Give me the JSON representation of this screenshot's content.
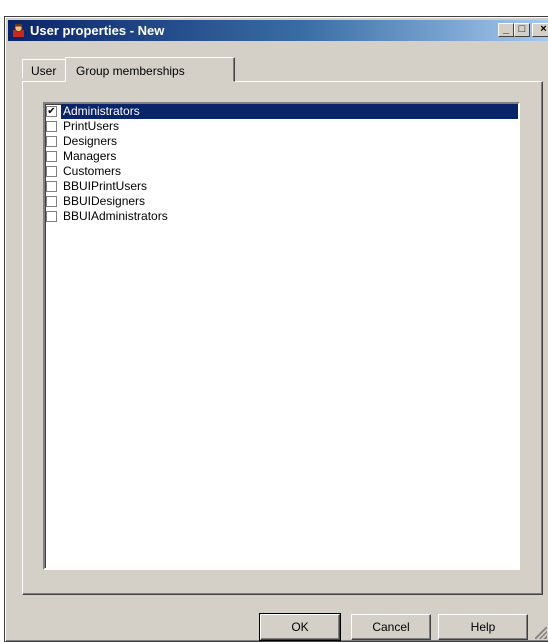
{
  "window": {
    "title": "User properties - New",
    "title_icon": "user-properties-icon",
    "minimize_symbol": "_",
    "maximize_symbol": "□",
    "close_symbol": "×"
  },
  "tabs": [
    {
      "label": "User",
      "active": false
    },
    {
      "label": "Group memberships",
      "active": true
    }
  ],
  "groups": [
    {
      "label": "Administrators",
      "checked": true,
      "selected": true
    },
    {
      "label": "PrintUsers",
      "checked": false,
      "selected": false
    },
    {
      "label": "Designers",
      "checked": false,
      "selected": false
    },
    {
      "label": "Managers",
      "checked": false,
      "selected": false
    },
    {
      "label": "Customers",
      "checked": false,
      "selected": false
    },
    {
      "label": "BBUIPrintUsers",
      "checked": false,
      "selected": false
    },
    {
      "label": "BBUIDesigners",
      "checked": false,
      "selected": false
    },
    {
      "label": "BBUIAdministrators",
      "checked": false,
      "selected": false
    }
  ],
  "buttons": {
    "ok": "OK",
    "cancel": "Cancel",
    "help": "Help"
  },
  "colors": {
    "selection": "#0a246a",
    "face": "#d4d0c8"
  }
}
